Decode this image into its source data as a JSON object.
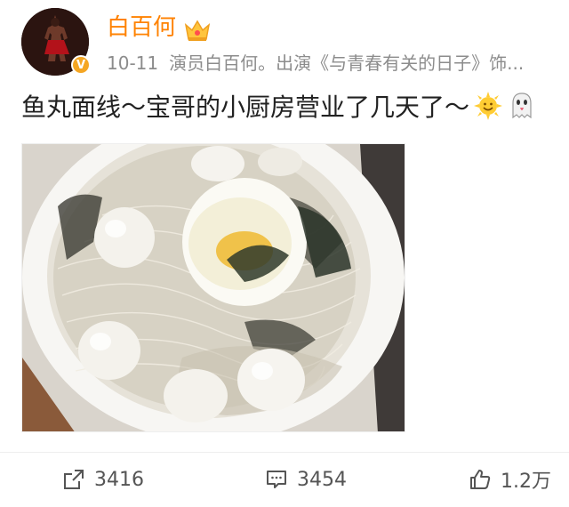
{
  "user": {
    "name": "白百何",
    "time": "10-11",
    "bio": "演员白百何。出演《与青春有关的日子》饰..."
  },
  "post": {
    "text": "鱼丸面线～宝哥的小厨房营业了几天了～",
    "emojis": [
      "sun-smiley-emoji",
      "ghost-emoji"
    ]
  },
  "actions": {
    "repost_count": "3416",
    "comment_count": "3454",
    "like_count": "1.2万"
  },
  "colors": {
    "username": "#ff8200",
    "meta": "#8c8c8c",
    "text": "#222222",
    "action": "#555555"
  }
}
